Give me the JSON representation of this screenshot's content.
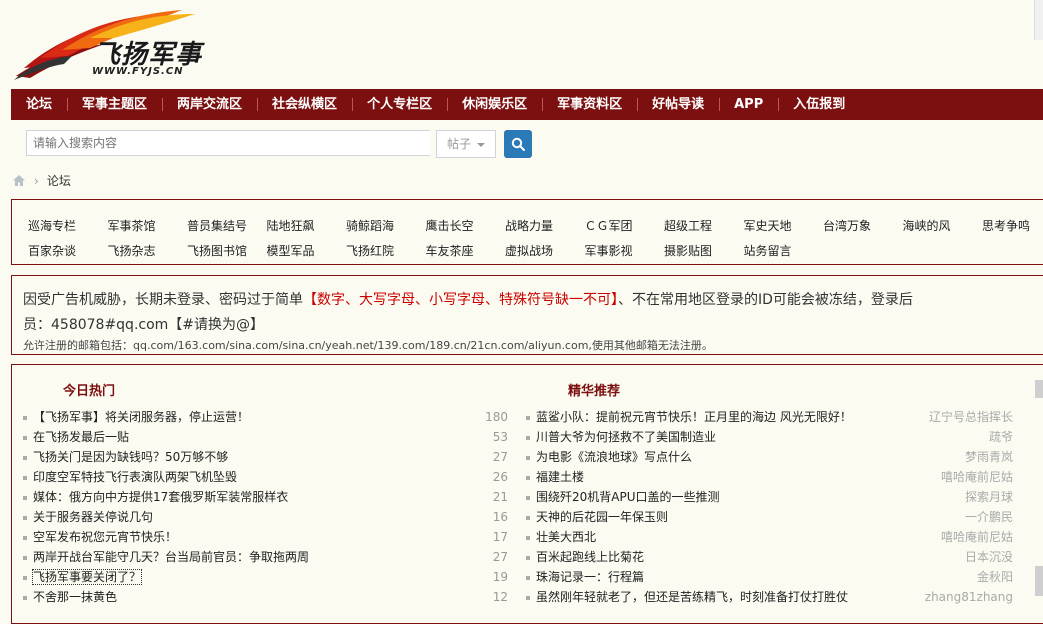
{
  "logo": {
    "title": "飞扬军事",
    "url": "WWW.FYJS.CN"
  },
  "nav": [
    "论坛",
    "军事主题区",
    "两岸交流区",
    "社会纵横区",
    "个人专栏区",
    "休闲娱乐区",
    "军事资料区",
    "好帖导读",
    "APP",
    "入伍报到"
  ],
  "search": {
    "placeholder": "请输入搜索内容",
    "scope": "帖子"
  },
  "breadcrumb": {
    "current": "论坛"
  },
  "forums": {
    "row1": [
      "巡海专栏",
      "军事茶馆",
      "普员集结号",
      "陆地狂飙",
      "骑鲸蹈海",
      "鹰击长空",
      "战略力量",
      "ＣＧ军团",
      "超级工程",
      "军史天地",
      "台湾万象",
      "海峡的风",
      "思考争鸣"
    ],
    "row2": [
      "百家杂谈",
      "飞扬杂志",
      "飞扬图书馆",
      "模型军品",
      "飞扬红院",
      "车友茶座",
      "虚拟战场",
      "军事影视",
      "摄影贴图",
      "站务留言"
    ]
  },
  "notice": {
    "line1_a": "因受广告机威胁，长期未登录、密码过于简单",
    "line1_red": "【数字、大写字母、小写字母、特殊符号缺一不可】",
    "line1_b": "、不在常用地区登录的ID可能会被冻结，登录后",
    "line2": "员：458078#qq.com【#请换为@】",
    "line3": "允许注册的邮箱包括：qq.com/163.com/sina.com/sina.cn/yeah.net/139.com/189.cn/21cn.com/aliyun.com,使用其他邮箱无法注册。"
  },
  "hot": {
    "title": "今日热门",
    "items": [
      {
        "title": "【飞扬军事】将关闭服务器，停止运营！",
        "count": "180"
      },
      {
        "title": "在飞扬发最后一贴",
        "count": "53"
      },
      {
        "title": "飞扬关门是因为缺钱吗？50万够不够",
        "count": "27"
      },
      {
        "title": "印度空军特技飞行表演队两架飞机坠毁",
        "count": "26"
      },
      {
        "title": "媒体：俄方向中方提供17套俄罗斯军装常服样衣",
        "count": "21"
      },
      {
        "title": "关于服务器关停说几句",
        "count": "16"
      },
      {
        "title": "空军发布祝您元宵节快乐！",
        "count": "17"
      },
      {
        "title": "两岸开战台军能守几天？台当局前官员：争取拖两周",
        "count": "27"
      },
      {
        "title": "飞扬军事要关闭了？",
        "count": "19"
      },
      {
        "title": "不舍那一抹黄色",
        "count": "12"
      }
    ]
  },
  "digest": {
    "title": "精华推荐",
    "items": [
      {
        "title": "蓝鲨小队：提前祝元宵节快乐！正月里的海边 风光无限好！",
        "author": "辽宁号总指挥长"
      },
      {
        "title": "川普大爷为何拯救不了美国制造业",
        "author": "疏爷"
      },
      {
        "title": "为电影《流浪地球》写点什么",
        "author": "梦雨青岚"
      },
      {
        "title": "福建土楼",
        "author": "嘻哈庵前尼姑"
      },
      {
        "title": "围绕歼20机背APU口盖的一些推测",
        "author": "探索月球"
      },
      {
        "title": "天神的后花园一年保玉则",
        "author": "一介鹏民"
      },
      {
        "title": "壮美大西北",
        "author": "嘻哈庵前尼姑"
      },
      {
        "title": "百米起跑线上比菊花",
        "author": "日本沉没"
      },
      {
        "title": "珠海记录一：行程篇",
        "author": "金秋阳"
      },
      {
        "title": "虽然刚年轻就老了，但还是苦练精飞，时刻准备打仗打胜仗",
        "author": "zhang81zhang"
      }
    ]
  },
  "colors": {
    "brand": "#7c0f0f",
    "accent_red": "#cc0000",
    "search_btn": "#2a7ab8",
    "background": "#fbfbf2"
  }
}
